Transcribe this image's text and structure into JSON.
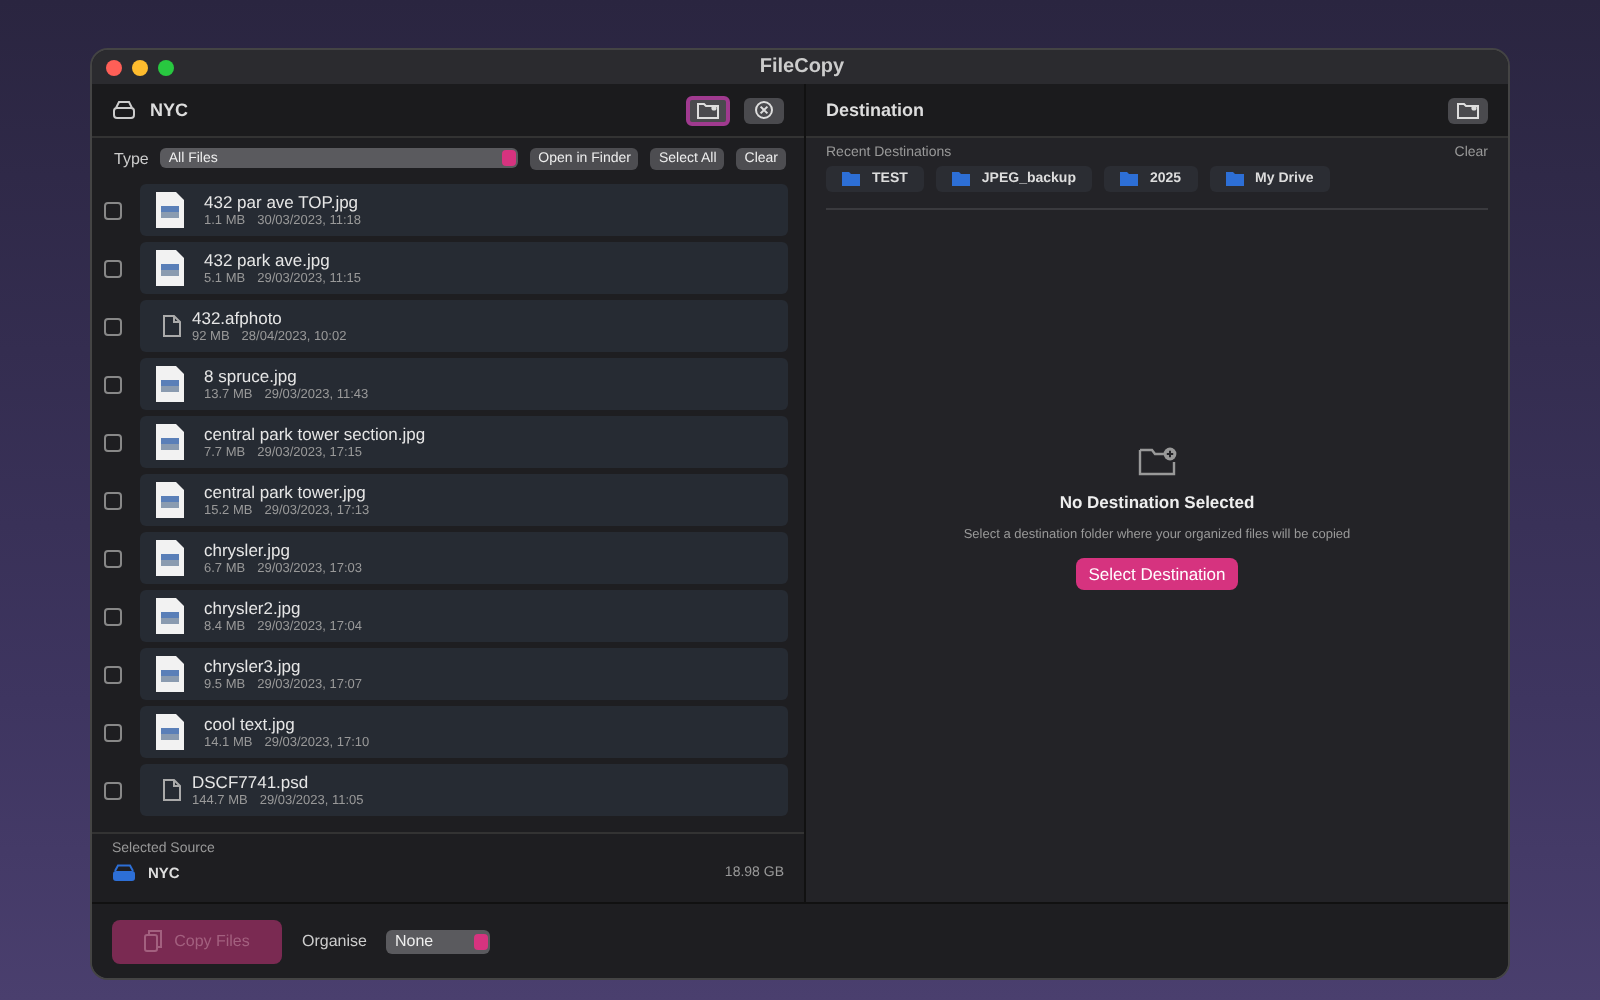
{
  "window": {
    "title": "FileCopy"
  },
  "source": {
    "name": "NYC"
  },
  "filter": {
    "label": "Type",
    "value": "All Files",
    "buttons": [
      "Open in Finder",
      "Select All",
      "Clear"
    ]
  },
  "files": [
    {
      "kind": "image",
      "name": "432 par ave TOP.jpg",
      "size": "1.1 MB",
      "date": "30/03/2023, 11:18",
      "checked": false
    },
    {
      "kind": "image",
      "name": "432 park ave.jpg",
      "size": "5.1 MB",
      "date": "29/03/2023, 11:15",
      "checked": false
    },
    {
      "kind": "document",
      "name": "432.afphoto",
      "size": "92 MB",
      "date": "28/04/2023, 10:02",
      "checked": false
    },
    {
      "kind": "image",
      "name": "8 spruce.jpg",
      "size": "13.7 MB",
      "date": "29/03/2023, 11:43",
      "checked": false
    },
    {
      "kind": "image",
      "name": "central park tower section.jpg",
      "size": "7.7 MB",
      "date": "29/03/2023, 17:15",
      "checked": false
    },
    {
      "kind": "image",
      "name": "central park tower.jpg",
      "size": "15.2 MB",
      "date": "29/03/2023, 17:13",
      "checked": false
    },
    {
      "kind": "image",
      "name": "chrysler.jpg",
      "size": "6.7 MB",
      "date": "29/03/2023, 17:03",
      "checked": false
    },
    {
      "kind": "image",
      "name": "chrysler2.jpg",
      "size": "8.4 MB",
      "date": "29/03/2023, 17:04",
      "checked": false
    },
    {
      "kind": "image",
      "name": "chrysler3.jpg",
      "size": "9.5 MB",
      "date": "29/03/2023, 17:07",
      "checked": false
    },
    {
      "kind": "image",
      "name": "cool text.jpg",
      "size": "14.1 MB",
      "date": "29/03/2023, 17:10",
      "checked": false
    },
    {
      "kind": "document",
      "name": "DSCF7741.psd",
      "size": "144.7 MB",
      "date": "29/03/2023, 11:05",
      "checked": false
    }
  ],
  "selected_source": {
    "heading": "Selected Source",
    "name": "NYC",
    "size": "18.98 GB"
  },
  "destination": {
    "title": "Destination",
    "recent_heading": "Recent Destinations",
    "clear": "Clear",
    "recent": [
      "TEST",
      "JPEG_backup",
      "2025",
      "My Drive"
    ],
    "empty_title": "No Destination Selected",
    "empty_text": "Select a destination folder where your organized files will be copied",
    "button": "Select Destination"
  },
  "footer": {
    "copy_button": {
      "label": "Copy Files",
      "disabled": true
    },
    "organise_label": "Organise",
    "organise_value": "None"
  }
}
